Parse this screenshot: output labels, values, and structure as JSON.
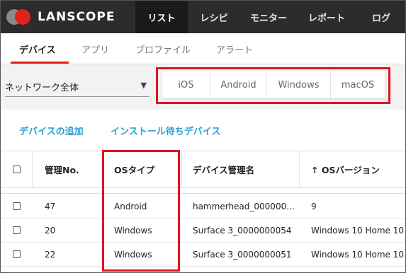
{
  "app": {
    "name": "LANSCOPE"
  },
  "topnav": {
    "items": [
      {
        "label": "リスト"
      },
      {
        "label": "レシピ"
      },
      {
        "label": "モニター"
      },
      {
        "label": "レポート"
      },
      {
        "label": "ログ"
      }
    ]
  },
  "subtabs": [
    {
      "label": "デバイス"
    },
    {
      "label": "アプリ"
    },
    {
      "label": "プロファイル"
    },
    {
      "label": "アラート"
    }
  ],
  "filter": {
    "scope_select": "ネットワーク全体",
    "os_buttons": [
      {
        "label": "iOS"
      },
      {
        "label": "Android"
      },
      {
        "label": "Windows"
      },
      {
        "label": "macOS"
      }
    ]
  },
  "actions": {
    "add_device": "デバイスの追加",
    "pending_install": "インストール待ちデバイス"
  },
  "table": {
    "headers": {
      "mgmt_no": "管理No.",
      "os_type": "OSタイプ",
      "device_name": "デバイス管理名",
      "os_version": "↑ OSバージョン"
    },
    "rows": [
      {
        "mgmt_no": "47",
        "os_type": "Android",
        "device_name": "hammerhead_000000...",
        "os_version": "9"
      },
      {
        "mgmt_no": "20",
        "os_type": "Windows",
        "device_name": "Surface 3_0000000054",
        "os_version": "Windows 10 Home 10"
      },
      {
        "mgmt_no": "22",
        "os_type": "Windows",
        "device_name": "Surface 3_0000000051",
        "os_version": "Windows 10 Home 10"
      }
    ]
  },
  "colors": {
    "topbar": "#2c2c2c",
    "accent_red": "#e3211c",
    "highlight_red": "#e0141e",
    "link_blue": "#2a9fd0"
  }
}
